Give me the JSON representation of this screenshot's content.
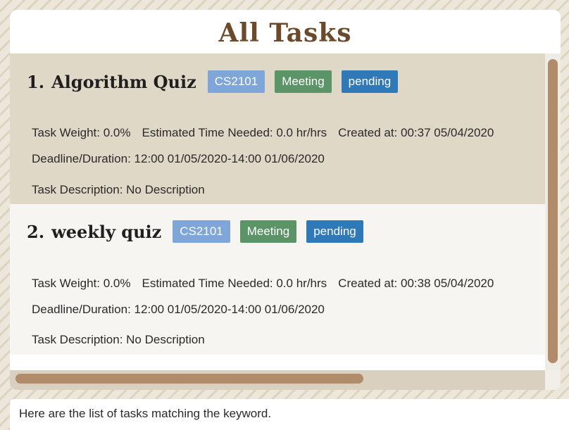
{
  "header": {
    "title": "All Tasks"
  },
  "tasks": [
    {
      "index": "1.",
      "name": "Algorithm Quiz",
      "module": "CS2101",
      "type": "Meeting",
      "status": "pending",
      "weight": "Task Weight: 0.0%",
      "time_needed": "Estimated Time Needed: 0.0 hr/hrs",
      "created": "Created at: 00:37 05/04/2020",
      "deadline": "Deadline/Duration: 12:00 01/05/2020-14:00 01/06/2020",
      "description": "Task Description: No Description"
    },
    {
      "index": "2.",
      "name": "weekly quiz",
      "module": "CS2101",
      "type": "Meeting",
      "status": "pending",
      "weight": "Task Weight: 0.0%",
      "time_needed": "Estimated Time Needed: 0.0 hr/hrs",
      "created": "Created at: 00:38 05/04/2020",
      "deadline": "Deadline/Duration: 12:00 01/05/2020-14:00 01/06/2020",
      "description": "Task Description: No Description"
    }
  ],
  "result": {
    "message": "Here are the list of tasks matching the keyword."
  },
  "colors": {
    "title": "#6b4a2c",
    "selected_card": "#e0d8c7",
    "module_tag": "#7ea6d8",
    "type_tag": "#5b9466",
    "status_tag": "#2f79b9",
    "scrollbar_thumb": "#b08c6a"
  }
}
